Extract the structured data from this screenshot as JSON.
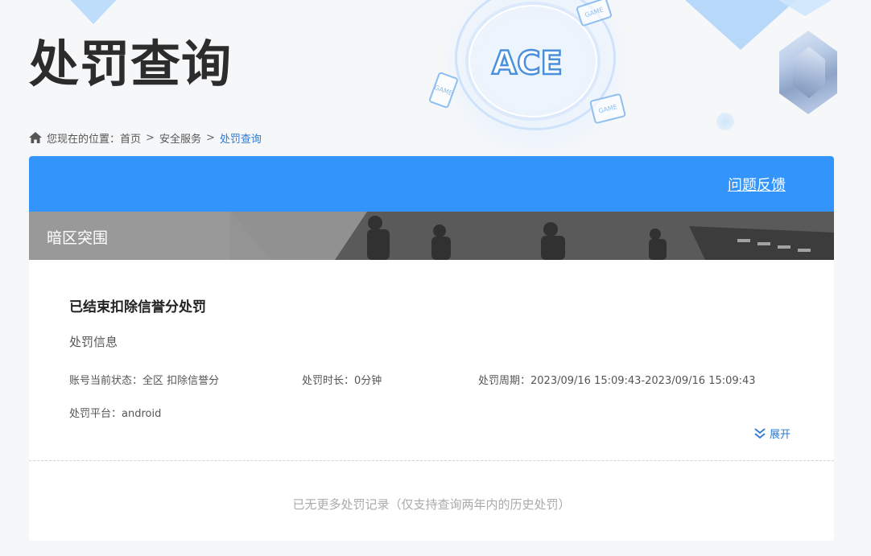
{
  "header": {
    "page_title": "处罚查询",
    "logo_text": "ACE",
    "device_label": "GAME"
  },
  "breadcrumb": {
    "prefix": "您现在的位置：",
    "items": [
      "首页",
      "安全服务",
      "处罚查询"
    ],
    "separator": ">"
  },
  "card": {
    "feedback_label": "问题反馈",
    "game_name": "暗区突围",
    "record": {
      "title": "已结束扣除信誉分处罚",
      "subtitle": "处罚信息",
      "status": "账号当前状态：全区 扣除信誉分",
      "duration": "处罚时长：0分钟",
      "period": "处罚周期：2023/09/16 15:09:43-2023/09/16 15:09:43",
      "platform": "处罚平台：android",
      "expand_label": "展开"
    },
    "no_more_text": "已无更多处罚记录（仅支持查询两年内的历史处罚）"
  },
  "colors": {
    "accent": "#3394fb",
    "link": "#2a7ad6",
    "title": "#2c2c2c"
  },
  "icons": {
    "home": "home-icon",
    "expand": "double-chevron-down-icon"
  }
}
